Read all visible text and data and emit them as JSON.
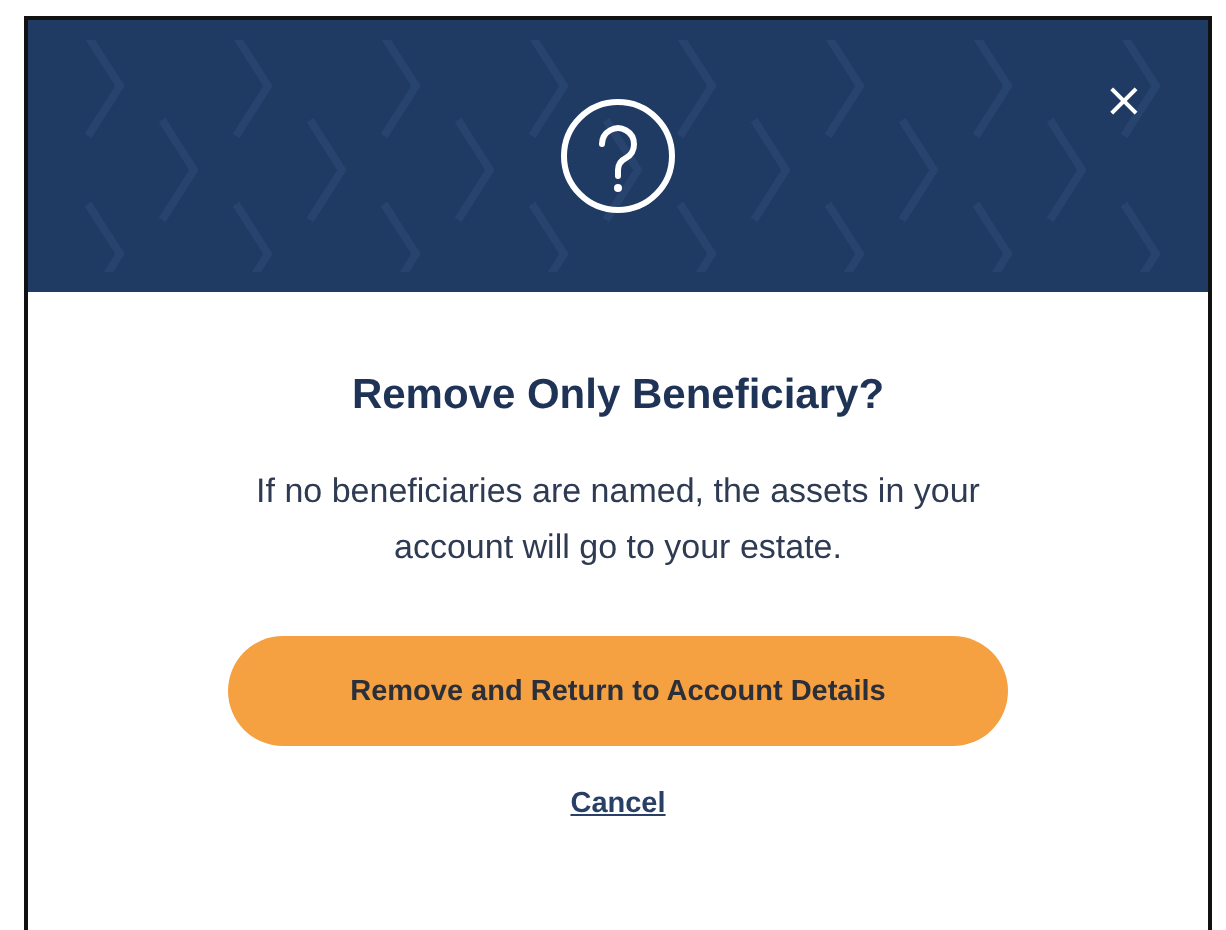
{
  "dialog": {
    "close": "×",
    "title": "Remove Only Beneficiary?",
    "message": "If no beneficiaries are named, the assets in your account will go to your estate.",
    "primary_button": "Remove and Return to Account Details",
    "cancel_link": "Cancel"
  }
}
